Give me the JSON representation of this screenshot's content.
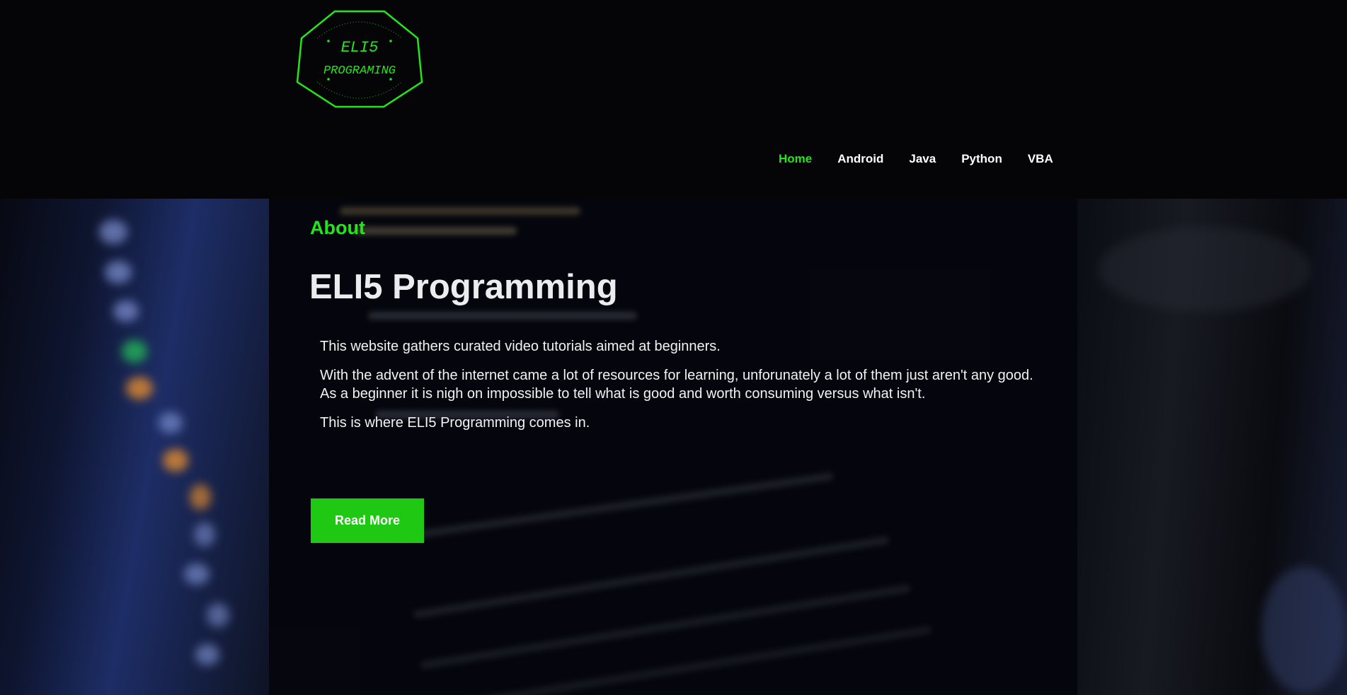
{
  "logo": {
    "line1": "ELI5",
    "line2": "PROGRAMING",
    "color": "#23e61a"
  },
  "nav": {
    "items": [
      {
        "label": "Home",
        "active": true
      },
      {
        "label": "Android",
        "active": false
      },
      {
        "label": "Java",
        "active": false
      },
      {
        "label": "Python",
        "active": false
      },
      {
        "label": "VBA",
        "active": false
      }
    ]
  },
  "hero": {
    "section_label": "About",
    "title": "ELI5 Programming",
    "paragraphs": [
      "This website gathers curated video tutorials aimed at beginners.",
      "With the advent of the internet came a lot of resources for learning, unforunately a lot of them just aren't any good. As a beginner it is nigh on impossible to tell what is good and worth consuming versus what isn't.",
      "This is where ELI5 Programming comes in."
    ],
    "button_label": "Read More"
  },
  "colors": {
    "accent": "#23e61a",
    "button": "#1fc812",
    "header_bg": "#050507",
    "text": "#f2f2f2"
  }
}
